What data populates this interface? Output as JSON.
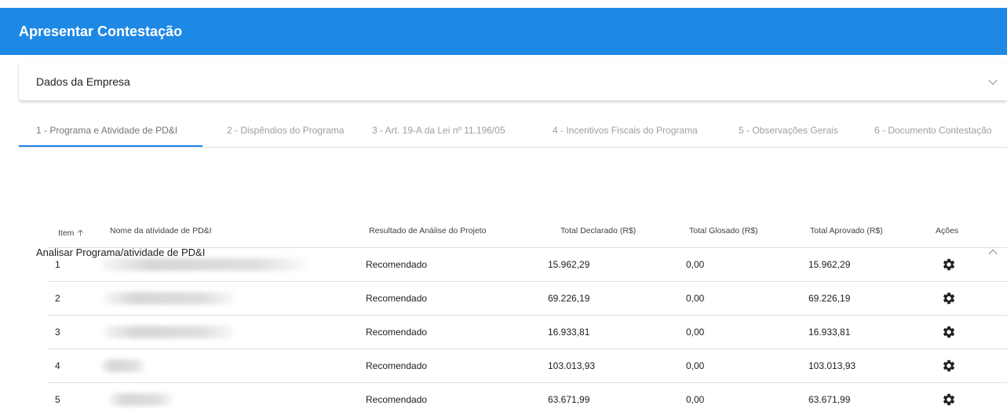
{
  "header": {
    "title": "Apresentar Contestação"
  },
  "empresa_panel": {
    "title": "Dados da Empresa"
  },
  "tabs": [
    {
      "label": "1 - Programa e Atividade de PD&I",
      "active": true
    },
    {
      "label": "2 - Dispêndios do Programa"
    },
    {
      "label": "3 - Art. 19-A da Lei nº 11.196/05"
    },
    {
      "label": "4 - Incentivos Fiscais do Programa"
    },
    {
      "label": "5 - Observações Gerais"
    },
    {
      "label": "6 - Documento Contestação"
    }
  ],
  "analisar_panel": {
    "title": "Analisar Programa/atividade de PD&I"
  },
  "table": {
    "headers": {
      "item": "Item",
      "nome": "Nome da atividade de PD&I",
      "resultado": "Resultado de Análise do Projeto",
      "declarado": "Total Declarado (R$)",
      "glosado": "Total Glosado (R$)",
      "aprovado": "Total Aprovado (R$)",
      "acoes": "Ações"
    },
    "rows": [
      {
        "item": "1",
        "resultado": "Recomendado",
        "declarado": "15.962,29",
        "glosado": "0,00",
        "aprovado": "15.962,29"
      },
      {
        "item": "2",
        "resultado": "Recomendado",
        "declarado": "69.226,19",
        "glosado": "0,00",
        "aprovado": "69.226,19"
      },
      {
        "item": "3",
        "resultado": "Recomendado",
        "declarado": "16.933,81",
        "glosado": "0,00",
        "aprovado": "16.933,81"
      },
      {
        "item": "4",
        "resultado": "Recomendado",
        "declarado": "103.013,93",
        "glosado": "0,00",
        "aprovado": "103.013,93"
      },
      {
        "item": "5",
        "resultado": "Recomendado",
        "declarado": "63.671,99",
        "glosado": "0,00",
        "aprovado": "63.671,99"
      }
    ]
  },
  "colors": {
    "header_bg": "#1e88e5",
    "accent": "#1e88e5"
  },
  "icons": {
    "sort": "arrow-up-icon",
    "action": "gear-icon",
    "expand": "chevron-down-icon",
    "collapse": "chevron-up-icon"
  }
}
